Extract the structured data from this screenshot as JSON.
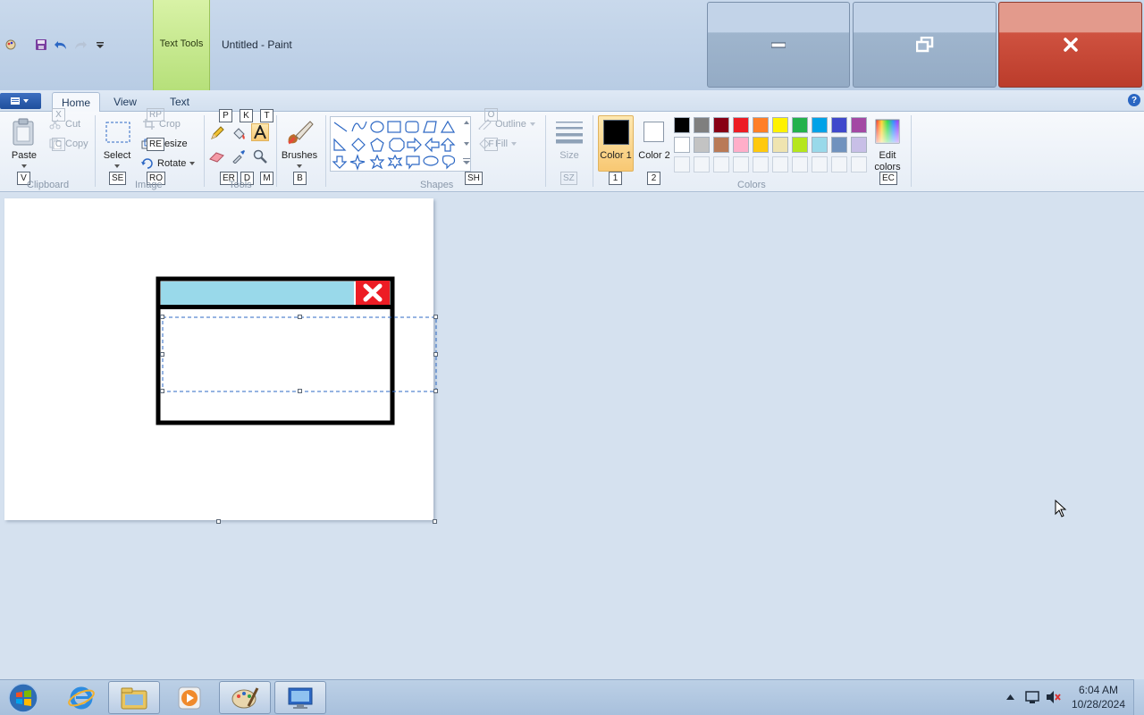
{
  "window": {
    "title": "Untitled - Paint",
    "contextual_tab": "Text Tools"
  },
  "tabs": {
    "home": "Home",
    "view": "View",
    "text": "Text"
  },
  "clipboard": {
    "paste": "Paste",
    "cut": "Cut",
    "copy": "Copy",
    "label": "Clipboard",
    "keytips": {
      "paste": "V",
      "cut": "X",
      "copy": "C"
    }
  },
  "image": {
    "select": "Select",
    "crop": "Crop",
    "resize": "Resize",
    "rotate": "Rotate",
    "label": "Image",
    "keytips": {
      "select": "SE",
      "crop": "RP",
      "resize": "RE",
      "rotate": "RO"
    }
  },
  "tools": {
    "label": "Tools",
    "keytips": {
      "pencil": "P",
      "fill": "K",
      "text": "T",
      "eraser": "ER",
      "picker": "D",
      "magnifier": "M"
    }
  },
  "brushes": {
    "label": "Brushes",
    "keytip": "B"
  },
  "shapes": {
    "label": "Shapes",
    "outline": "Outline",
    "fill": "Fill",
    "keytips": {
      "shapes": "SH",
      "outline": "O",
      "fill": "F"
    }
  },
  "size": {
    "label": "Size",
    "keytip": "SZ"
  },
  "color1": {
    "label": "Color 1",
    "keytip": "1",
    "value": "#000000"
  },
  "color2": {
    "label": "Color 2",
    "keytip": "2",
    "value": "#ffffff"
  },
  "colors": {
    "label": "Colors",
    "row1": [
      "#000000",
      "#7f7f7f",
      "#880015",
      "#ed1c24",
      "#ff7f27",
      "#fff200",
      "#22b14c",
      "#00a2e8",
      "#3f48cc",
      "#a349a4"
    ],
    "row2": [
      "#ffffff",
      "#c3c3c3",
      "#b97a57",
      "#ffaec9",
      "#ffc90e",
      "#efe4b0",
      "#b5e61d",
      "#99d9ea",
      "#7092be",
      "#c8bfe7"
    ]
  },
  "edit_colors": {
    "label": "Edit colors",
    "keytip": "EC"
  },
  "taskbar": {
    "time": "6:04 AM",
    "date": "10/28/2024"
  }
}
